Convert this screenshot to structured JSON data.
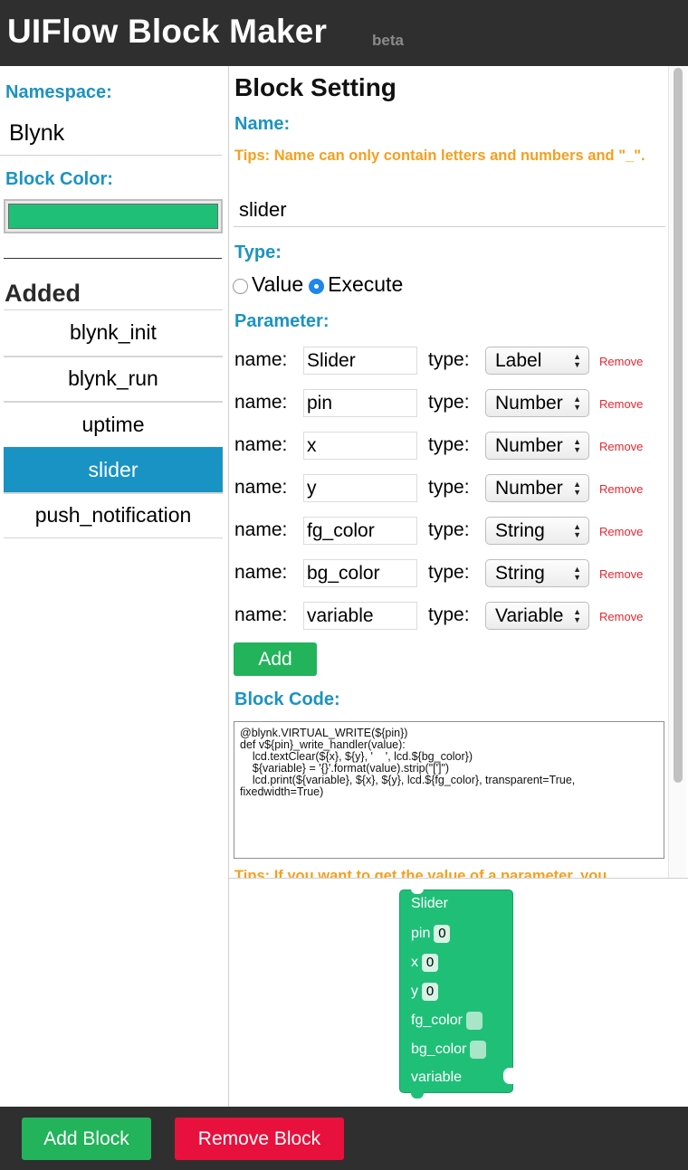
{
  "header": {
    "title": "UIFlow Block Maker",
    "badge": "beta"
  },
  "sidebar": {
    "namespace_label": "Namespace:",
    "namespace_value": "Blynk",
    "block_color_label": "Block Color:",
    "block_color": "#1fbf78",
    "added_title": "Added",
    "added_items": [
      {
        "label": "blynk_init"
      },
      {
        "label": "blynk_run"
      },
      {
        "label": "uptime"
      },
      {
        "label": "slider"
      },
      {
        "label": "push_notification"
      }
    ],
    "active_item": "slider"
  },
  "settings": {
    "title": "Block Setting",
    "name_label": "Name:",
    "name_tips": "Tips: Name can only contain letters and numbers and \"_\".",
    "name_value": "slider",
    "type_label": "Type:",
    "type_options": [
      "Value",
      "Execute"
    ],
    "type_selected": "Execute",
    "parameter_label": "Parameter:",
    "param_name_label": "name:",
    "param_type_label": "type:",
    "remove_label": "Remove",
    "parameters": [
      {
        "name": "Slider",
        "type": "Label"
      },
      {
        "name": "pin",
        "type": "Number"
      },
      {
        "name": "x",
        "type": "Number"
      },
      {
        "name": "y",
        "type": "Number"
      },
      {
        "name": "fg_color",
        "type": "String"
      },
      {
        "name": "bg_color",
        "type": "String"
      },
      {
        "name": "variable",
        "type": "Variable"
      }
    ],
    "add_label": "Add",
    "block_code_label": "Block Code:",
    "block_code": "@blynk.VIRTUAL_WRITE(${pin})\ndef v${pin}_write_handler(value):\n    lcd.textClear(${x}, ${y}, '    ', lcd.${bg_color})\n    ${variable} = '{}'.format(value).strip(\"[']\")\n    lcd.print(${variable}, ${x}, ${y}, lcd.${fg_color}, transparent=True,\nfixedwidth=True)",
    "code_tips": "Tips: If you want to get the value of a parameter, you"
  },
  "preview": {
    "block_title": "Slider",
    "rows": [
      {
        "label": "pin",
        "value": "0",
        "kind": "num"
      },
      {
        "label": "x",
        "value": "0",
        "kind": "num"
      },
      {
        "label": "y",
        "value": "0",
        "kind": "num"
      },
      {
        "label": "fg_color",
        "value": "",
        "kind": "blank"
      },
      {
        "label": "bg_color",
        "value": "",
        "kind": "blank"
      },
      {
        "label": "variable",
        "value": "",
        "kind": "input"
      }
    ]
  },
  "footer": {
    "add_block_label": "Add Block",
    "remove_block_label": "Remove Block"
  },
  "colors": {
    "accent": "#1b93c2",
    "tips": "#f5a01f",
    "add": "#22b35b",
    "remove": "#e8103c",
    "header_bg": "#2f2f2f"
  }
}
